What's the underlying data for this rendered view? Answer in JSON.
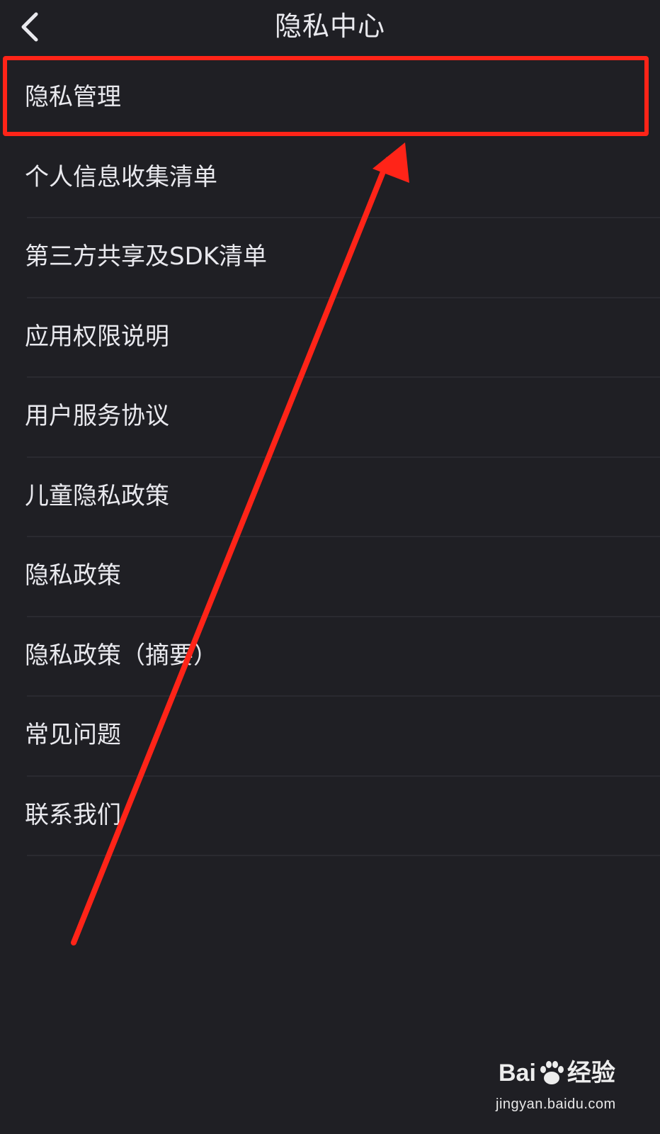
{
  "header": {
    "title": "隐私中心",
    "back_icon": "chevron-left-icon"
  },
  "menu": {
    "items": [
      {
        "label": "隐私管理",
        "highlighted": true
      },
      {
        "label": "个人信息收集清单"
      },
      {
        "label": "第三方共享及SDK清单"
      },
      {
        "label": "应用权限说明"
      },
      {
        "label": "用户服务协议"
      },
      {
        "label": "儿童隐私政策"
      },
      {
        "label": "隐私政策"
      },
      {
        "label": "隐私政策（摘要）"
      },
      {
        "label": "常见问题"
      },
      {
        "label": "联系我们"
      }
    ]
  },
  "annotation": {
    "highlight_color": "#ff2418",
    "arrow_color": "#ff2418"
  },
  "watermark": {
    "brand_prefix": "Bai",
    "brand_suffix": "经验",
    "url": "jingyan.baidu.com"
  },
  "colors": {
    "background": "#1f1f24",
    "text": "#e9e9ee",
    "divider": "#2a2a30"
  }
}
